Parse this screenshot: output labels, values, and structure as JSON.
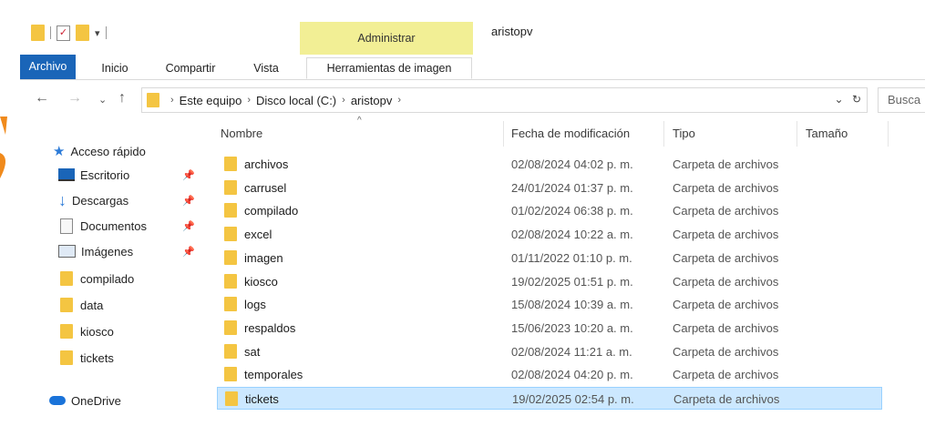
{
  "window": {
    "title": "aristopv",
    "contextual_tab_group": "Administrar"
  },
  "ribbon": {
    "tabs": [
      "Archivo",
      "Inicio",
      "Compartir",
      "Vista",
      "Herramientas de imagen"
    ]
  },
  "address": {
    "breadcrumbs": [
      "Este equipo",
      "Disco local (C:)",
      "aristopv"
    ],
    "search_placeholder": "Busca"
  },
  "sidebar": {
    "quick_access_label": "Acceso rápido",
    "items": [
      {
        "label": "Escritorio",
        "icon": "desktop-icon",
        "pinned": true
      },
      {
        "label": "Descargas",
        "icon": "download-icon",
        "pinned": true
      },
      {
        "label": "Documentos",
        "icon": "document-icon",
        "pinned": true
      },
      {
        "label": "Imágenes",
        "icon": "pictures-icon",
        "pinned": true
      },
      {
        "label": "compilado",
        "icon": "folder-icon",
        "pinned": false
      },
      {
        "label": "data",
        "icon": "folder-icon",
        "pinned": false
      },
      {
        "label": "kiosco",
        "icon": "folder-icon",
        "pinned": false
      },
      {
        "label": "tickets",
        "icon": "folder-icon",
        "pinned": false
      }
    ],
    "onedrive_label": "OneDrive"
  },
  "columns": {
    "name": "Nombre",
    "date": "Fecha de modificación",
    "type": "Tipo",
    "size": "Tamaño"
  },
  "files": [
    {
      "name": "archivos",
      "date": "02/08/2024 04:02 p. m.",
      "type": "Carpeta de archivos"
    },
    {
      "name": "carrusel",
      "date": "24/01/2024 01:37 p. m.",
      "type": "Carpeta de archivos"
    },
    {
      "name": "compilado",
      "date": "01/02/2024 06:38 p. m.",
      "type": "Carpeta de archivos"
    },
    {
      "name": "excel",
      "date": "02/08/2024 10:22 a. m.",
      "type": "Carpeta de archivos"
    },
    {
      "name": "imagen",
      "date": "01/11/2022 01:10 p. m.",
      "type": "Carpeta de archivos"
    },
    {
      "name": "kiosco",
      "date": "19/02/2025 01:51 p. m.",
      "type": "Carpeta de archivos"
    },
    {
      "name": "logs",
      "date": "15/08/2024 10:39 a. m.",
      "type": "Carpeta de archivos"
    },
    {
      "name": "respaldos",
      "date": "15/06/2023 10:20 a. m.",
      "type": "Carpeta de archivos"
    },
    {
      "name": "sat",
      "date": "02/08/2024 11:21 a. m.",
      "type": "Carpeta de archivos"
    },
    {
      "name": "temporales",
      "date": "02/08/2024 04:20 p. m.",
      "type": "Carpeta de archivos"
    },
    {
      "name": "tickets",
      "date": "19/02/2025 02:54 p. m.",
      "type": "Carpeta de archivos",
      "selected": true
    }
  ],
  "colors": {
    "accent": "#1a65b8",
    "contextual_tab": "#f2ef95",
    "folder": "#f4c542",
    "selection": "#cce8ff"
  }
}
